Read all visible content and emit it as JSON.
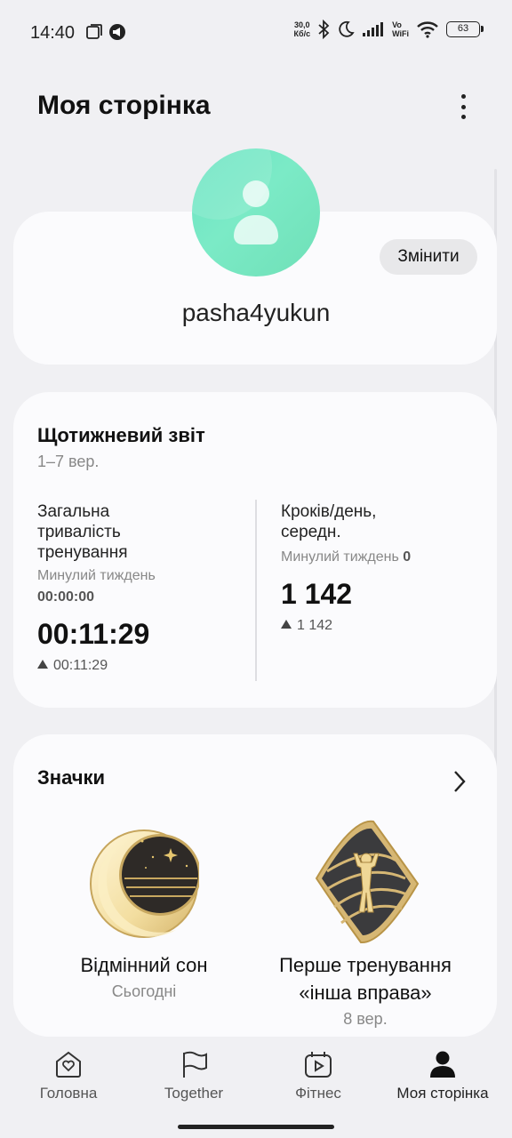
{
  "status_bar": {
    "time": "14:40",
    "net_speed_value": "30,0",
    "net_speed_unit": "Кб/с",
    "vowifi_top": "Vo",
    "vowifi_bottom": "WiFi",
    "battery": "63"
  },
  "header": {
    "title": "Моя сторінка"
  },
  "profile": {
    "edit_label": "Змінити",
    "username": "pasha4yukun",
    "avatar_color": "#6ce3c3"
  },
  "weekly_report": {
    "title": "Щотижневий звіт",
    "date_range": "1–7 вер.",
    "duration": {
      "label_line1": "Загальна",
      "label_line2": "тривалість",
      "label_line3": "тренування",
      "prev_week_label": "Минулий тиждень",
      "prev_week_value": "00:00:00",
      "value": "00:11:29",
      "delta": "00:11:29"
    },
    "steps": {
      "label_line1": "Кроків/день,",
      "label_line2": "середн.",
      "prev_week_label": "Минулий тиждень",
      "prev_week_value": "0",
      "value": "1 142",
      "delta": "1 142"
    }
  },
  "badges": {
    "title": "Значки",
    "items": [
      {
        "name_line1": "Відмінний сон",
        "name_line2": "",
        "date": "Сьогодні",
        "icon": "moon-badge-icon"
      },
      {
        "name_line1": "Перше тренування",
        "name_line2": "«інша вправа»",
        "date": "8 вер.",
        "icon": "workout-badge-icon"
      }
    ]
  },
  "bottom_nav": {
    "items": [
      {
        "label": "Головна",
        "icon": "home-heart-icon"
      },
      {
        "label": "Together",
        "icon": "flag-icon"
      },
      {
        "label": "Фітнес",
        "icon": "fitness-play-icon"
      },
      {
        "label": "Моя сторінка",
        "icon": "person-icon",
        "active": true
      }
    ]
  }
}
